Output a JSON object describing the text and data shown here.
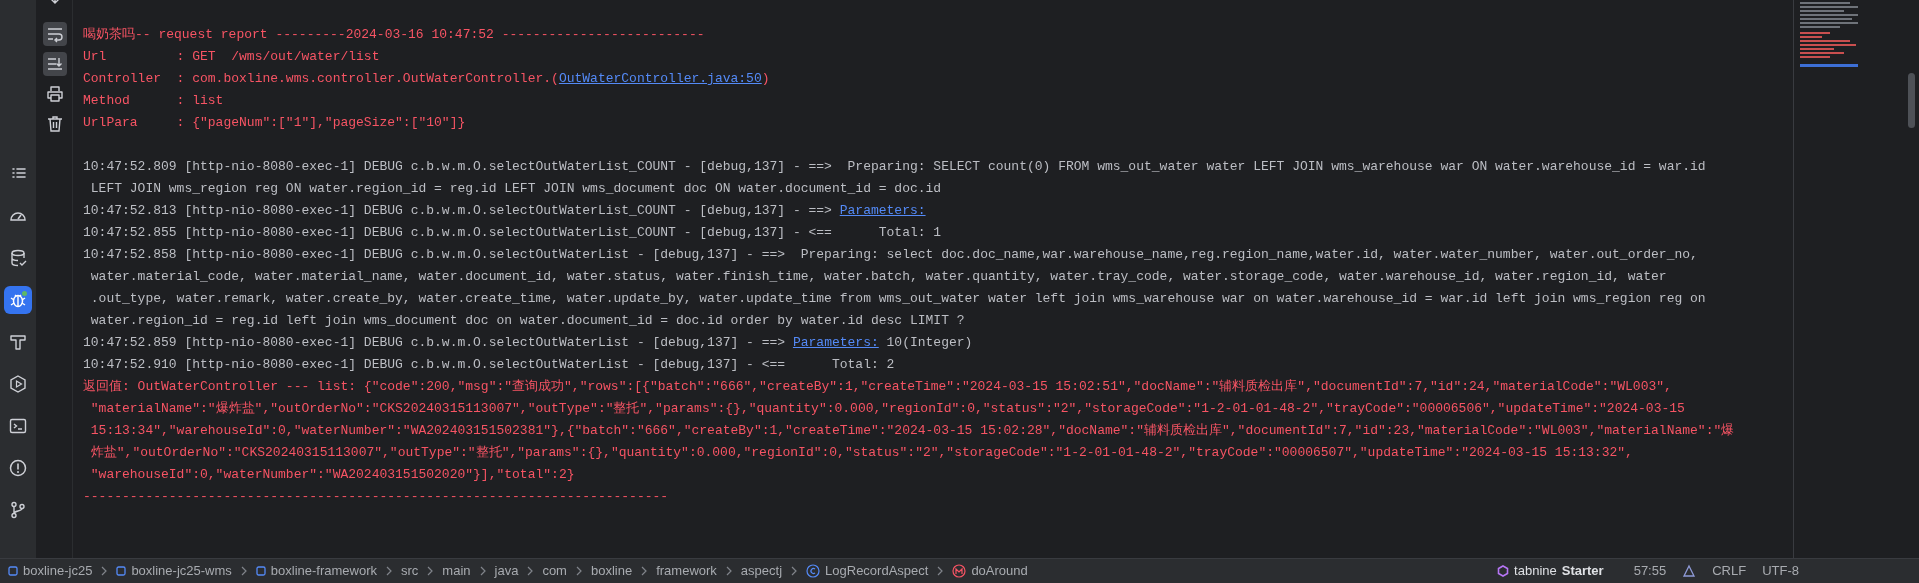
{
  "console": {
    "rows": [
      {
        "kind": "error",
        "segments": [
          {
            "kind": "plain",
            "text": "喝奶茶吗-- request report ---------2024-03-16 10:47:52 --------------------------"
          }
        ]
      },
      {
        "kind": "error",
        "segments": [
          {
            "kind": "plain",
            "text": "Url         : GET  /wms/out/water/list"
          }
        ]
      },
      {
        "kind": "error",
        "segments": [
          {
            "kind": "plain",
            "text": "Controller  : com.boxline.wms.controller.OutWaterController.("
          },
          {
            "kind": "link",
            "text": "OutWaterController.java:50"
          },
          {
            "kind": "plain",
            "text": ")"
          }
        ]
      },
      {
        "kind": "error",
        "segments": [
          {
            "kind": "plain",
            "text": "Method      : list"
          }
        ]
      },
      {
        "kind": "error",
        "segments": [
          {
            "kind": "plain",
            "text": "UrlPara     : {\"pageNum\":[\"1\"],\"pageSize\":[\"10\"]}"
          }
        ]
      },
      {
        "kind": "blank"
      },
      {
        "kind": "info",
        "segments": [
          {
            "kind": "plain",
            "text": "10:47:52.809 [http-nio-8080-exec-1] DEBUG c.b.w.m.O.selectOutWaterList_COUNT - [debug,137] - ==>  Preparing: SELECT count(0) FROM wms_out_water water LEFT JOIN wms_warehouse war ON water.warehouse_id = war.id"
          }
        ]
      },
      {
        "kind": "info",
        "segments": [
          {
            "kind": "plain",
            "text": " LEFT JOIN wms_region reg ON water.region_id = reg.id LEFT JOIN wms_document doc ON water.document_id = doc.id"
          }
        ]
      },
      {
        "kind": "info",
        "segments": [
          {
            "kind": "plain",
            "text": "10:47:52.813 [http-nio-8080-exec-1] DEBUG c.b.w.m.O.selectOutWaterList_COUNT - [debug,137] - ==> "
          },
          {
            "kind": "link",
            "text": "Parameters:"
          }
        ]
      },
      {
        "kind": "info",
        "segments": [
          {
            "kind": "plain",
            "text": "10:47:52.855 [http-nio-8080-exec-1] DEBUG c.b.w.m.O.selectOutWaterList_COUNT - [debug,137] - <==      Total: 1"
          }
        ]
      },
      {
        "kind": "info",
        "segments": [
          {
            "kind": "plain",
            "text": "10:47:52.858 [http-nio-8080-exec-1] DEBUG c.b.w.m.O.selectOutWaterList - [debug,137] - ==>  Preparing: select doc.doc_name,war.warehouse_name,reg.region_name,water.id, water.water_number, water.out_order_no,"
          }
        ]
      },
      {
        "kind": "info",
        "segments": [
          {
            "kind": "plain",
            "text": " water.material_code, water.material_name, water.document_id, water.status, water.finish_time, water.batch, water.quantity, water.tray_code, water.storage_code, water.warehouse_id, water.region_id, water"
          }
        ]
      },
      {
        "kind": "info",
        "segments": [
          {
            "kind": "plain",
            "text": " .out_type, water.remark, water.create_by, water.create_time, water.update_by, water.update_time from wms_out_water water left join wms_warehouse war on water.warehouse_id = war.id left join wms_region reg on"
          }
        ]
      },
      {
        "kind": "info",
        "segments": [
          {
            "kind": "plain",
            "text": " water.region_id = reg.id left join wms_document doc on water.document_id = doc.id order by water.id desc LIMIT ?"
          }
        ]
      },
      {
        "kind": "info",
        "segments": [
          {
            "kind": "plain",
            "text": "10:47:52.859 [http-nio-8080-exec-1] DEBUG c.b.w.m.O.selectOutWaterList - [debug,137] - ==> "
          },
          {
            "kind": "link",
            "text": "Parameters:"
          },
          {
            "kind": "plain",
            "text": " 10(Integer)"
          }
        ]
      },
      {
        "kind": "info",
        "segments": [
          {
            "kind": "plain",
            "text": "10:47:52.910 [http-nio-8080-exec-1] DEBUG c.b.w.m.O.selectOutWaterList - [debug,137] - <==      Total: 2"
          }
        ]
      },
      {
        "kind": "error",
        "segments": [
          {
            "kind": "plain",
            "text": "返回值: OutWaterController --- list: {\"code\":200,\"msg\":\"查询成功\",\"rows\":[{\"batch\":\"666\",\"createBy\":1,\"createTime\":\"2024-03-15 15:02:51\",\"docName\":\"辅料质检出库\",\"documentId\":7,\"id\":24,\"materialCode\":\"WL003\","
          }
        ]
      },
      {
        "kind": "error",
        "segments": [
          {
            "kind": "plain",
            "text": " \"materialName\":\"爆炸盐\",\"outOrderNo\":\"CKS20240315113007\",\"outType\":\"整托\",\"params\":{},\"quantity\":0.000,\"regionId\":0,\"status\":\"2\",\"storageCode\":\"1-2-01-01-48-2\",\"trayCode\":\"00006506\",\"updateTime\":\"2024-03-15"
          }
        ]
      },
      {
        "kind": "error",
        "segments": [
          {
            "kind": "plain",
            "text": " 15:13:34\",\"warehouseId\":0,\"waterNumber\":\"WA202403151502381\"},{\"batch\":\"666\",\"createBy\":1,\"createTime\":\"2024-03-15 15:02:28\",\"docName\":\"辅料质检出库\",\"documentId\":7,\"id\":23,\"materialCode\":\"WL003\",\"materialName\":\"爆"
          }
        ]
      },
      {
        "kind": "error",
        "segments": [
          {
            "kind": "plain",
            "text": " 炸盐\",\"outOrderNo\":\"CKS20240315113007\",\"outType\":\"整托\",\"params\":{},\"quantity\":0.000,\"regionId\":0,\"status\":\"2\",\"storageCode\":\"1-2-01-01-48-2\",\"trayCode\":\"00006507\",\"updateTime\":\"2024-03-15 15:13:32\","
          }
        ]
      },
      {
        "kind": "error",
        "segments": [
          {
            "kind": "plain",
            "text": " \"warehouseId\":0,\"waterNumber\":\"WA202403151502020\"}],\"total\":2}"
          }
        ]
      },
      {
        "kind": "error",
        "segments": [
          {
            "kind": "plain",
            "text": "---------------------------------------------------------------------------"
          }
        ]
      }
    ]
  },
  "tool_window_bar": [
    {
      "kind": "list",
      "selected": false
    },
    {
      "kind": "gauge",
      "selected": false
    },
    {
      "kind": "database",
      "selected": false
    },
    {
      "kind": "bug",
      "selected": true
    },
    {
      "kind": "hammer",
      "selected": false
    },
    {
      "kind": "play",
      "selected": false
    },
    {
      "kind": "terminal",
      "selected": false
    },
    {
      "kind": "alert",
      "selected": false
    },
    {
      "kind": "branch",
      "selected": false
    }
  ],
  "console_toolbar": [
    {
      "kind": "down",
      "selected": false
    },
    {
      "kind": "wrap",
      "selected": true
    },
    {
      "kind": "scroll-end",
      "selected": true
    },
    {
      "kind": "print",
      "selected": false
    },
    {
      "kind": "trash",
      "selected": false
    }
  ],
  "status_bar": {
    "breadcrumbs": [
      {
        "kind": "module",
        "text": "boxline-jc25"
      },
      {
        "kind": "module",
        "text": "boxline-jc25-wms"
      },
      {
        "kind": "module",
        "text": "boxline-framework"
      },
      {
        "kind": "folder",
        "text": "src"
      },
      {
        "kind": "folder",
        "text": "main"
      },
      {
        "kind": "folder",
        "text": "java"
      },
      {
        "kind": "folder",
        "text": "com"
      },
      {
        "kind": "folder",
        "text": "boxline"
      },
      {
        "kind": "folder",
        "text": "framework"
      },
      {
        "kind": "folder",
        "text": "aspectj"
      },
      {
        "kind": "class",
        "text": "LogRecordAspect"
      },
      {
        "kind": "method",
        "text": "doAround"
      }
    ],
    "plugin": {
      "brand": "tabnine",
      "tier": "Starter"
    },
    "position": "57:55",
    "line_separator": "CRLF",
    "encoding": "UTF-8"
  }
}
